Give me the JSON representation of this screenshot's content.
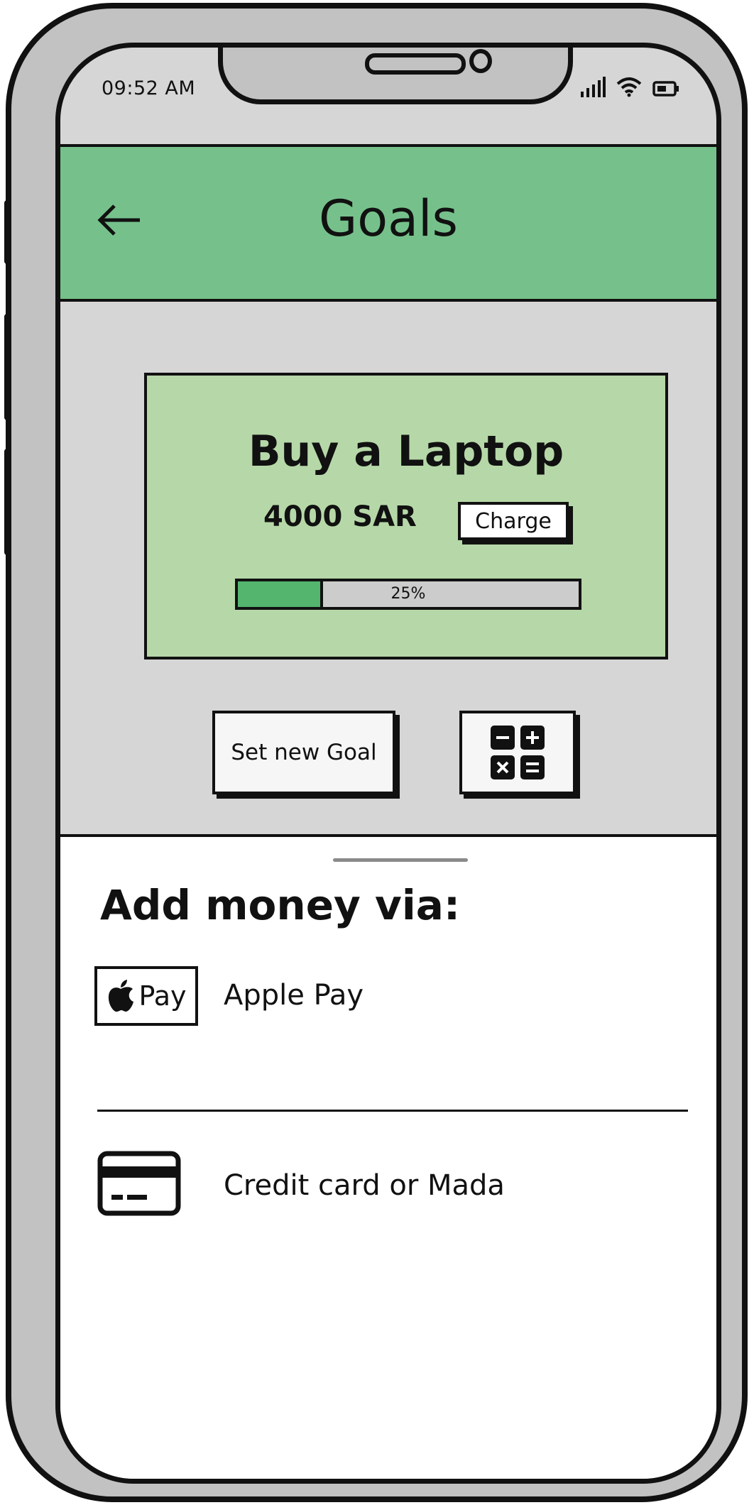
{
  "status_bar": {
    "time": "09:52 AM",
    "icons": [
      "signal-icon",
      "wifi-icon",
      "battery-icon"
    ]
  },
  "header": {
    "title": "Goals",
    "back_icon": "arrow-left-icon",
    "background": "#76c18b"
  },
  "goal": {
    "title": "Buy a Laptop",
    "amount": "4000 SAR",
    "charge_label": "Charge",
    "progress_percent": 25,
    "progress_label": "25%",
    "card_color": "#b6d8a8",
    "progress_color": "#54b56e"
  },
  "actions": {
    "set_goal_label": "Set new Goal",
    "calculator_icon": "calculator-icon"
  },
  "add_money": {
    "title": "Add money via:",
    "methods": [
      {
        "label": "Apple Pay",
        "badge_text": "Pay",
        "icon": "apple-pay-icon"
      },
      {
        "label": "Credit card or Mada",
        "icon": "credit-card-icon"
      }
    ]
  }
}
